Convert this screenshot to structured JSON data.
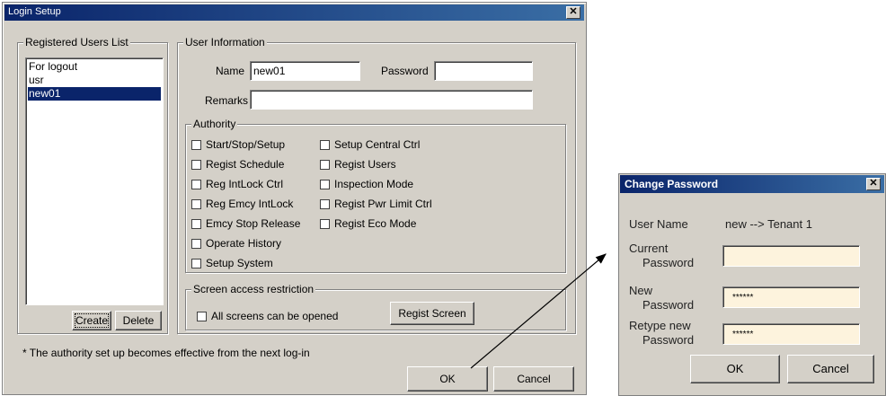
{
  "login_window": {
    "title": "Login Setup",
    "close_glyph": "✕",
    "users_group": {
      "legend": "Registered Users List",
      "users": [
        "For logout",
        "usr",
        "new01"
      ],
      "selected_index": 2,
      "create_label": "Create",
      "delete_label": "Delete"
    },
    "user_info": {
      "legend": "User Information",
      "name_label": "Name",
      "name_value": "new01",
      "password_label": "Password",
      "password_value": "",
      "remarks_label": "Remarks",
      "remarks_value": ""
    },
    "authority": {
      "legend": "Authority",
      "left": [
        "Start/Stop/Setup",
        "Regist Schedule",
        "Reg IntLock Ctrl",
        "Reg Emcy IntLock",
        "Emcy Stop Release",
        "Operate History",
        "Setup System"
      ],
      "right": [
        "Setup Central Ctrl",
        "Regist Users",
        "Inspection Mode",
        "Regist Pwr Limit Ctrl",
        "Regist Eco Mode"
      ]
    },
    "screen_access": {
      "legend": "Screen access restriction",
      "all_screens_label": "All screens can be opened",
      "regist_screen_label": "Regist Screen"
    },
    "note": "* The authority set up becomes effective from the next log-in",
    "ok_label": "OK",
    "cancel_label": "Cancel"
  },
  "change_password": {
    "title": "Change Password",
    "close_glyph": "✕",
    "user_name_label": "User Name",
    "user_name_value": "new --> Tenant 1",
    "current_label_1": "Current",
    "current_label_2": "Password",
    "current_value": "",
    "new_label_1": "New",
    "new_label_2": "Password",
    "new_value": "******",
    "retype_label_1": "Retype new",
    "retype_label_2": "Password",
    "retype_value": "******",
    "ok_label": "OK",
    "cancel_label": "Cancel"
  }
}
